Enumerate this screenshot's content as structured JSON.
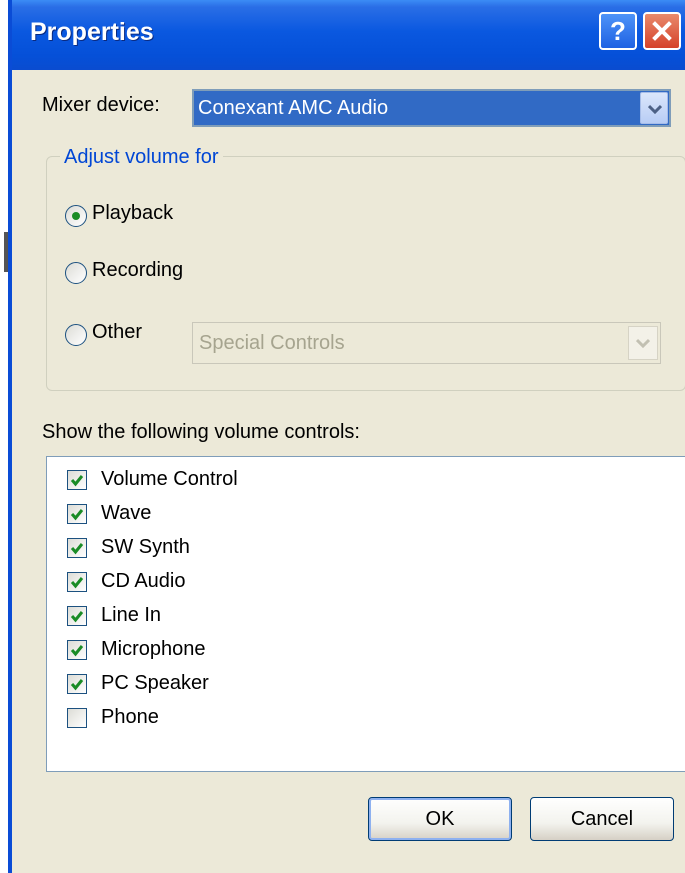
{
  "window": {
    "title": "Properties",
    "help_label": "?"
  },
  "mixer": {
    "label": "Mixer device:",
    "value": "Conexant AMC Audio"
  },
  "adjust": {
    "legend": "Adjust volume for",
    "options": [
      {
        "label": "Playback",
        "checked": true
      },
      {
        "label": "Recording",
        "checked": false
      },
      {
        "label": "Other",
        "checked": false
      }
    ],
    "other_select_value": "Special Controls"
  },
  "controls": {
    "label": "Show the following volume controls:",
    "items": [
      {
        "label": "Volume Control",
        "checked": true
      },
      {
        "label": "Wave",
        "checked": true
      },
      {
        "label": "SW Synth",
        "checked": true
      },
      {
        "label": "CD Audio",
        "checked": true
      },
      {
        "label": "Line In",
        "checked": true
      },
      {
        "label": "Microphone",
        "checked": true
      },
      {
        "label": "PC Speaker",
        "checked": true
      },
      {
        "label": "Phone",
        "checked": false
      }
    ]
  },
  "buttons": {
    "ok": "OK",
    "cancel": "Cancel"
  },
  "colors": {
    "titlebar": "#0a58e0",
    "close": "#d5422a",
    "check": "#1a8c26",
    "selection": "#316ac5"
  }
}
